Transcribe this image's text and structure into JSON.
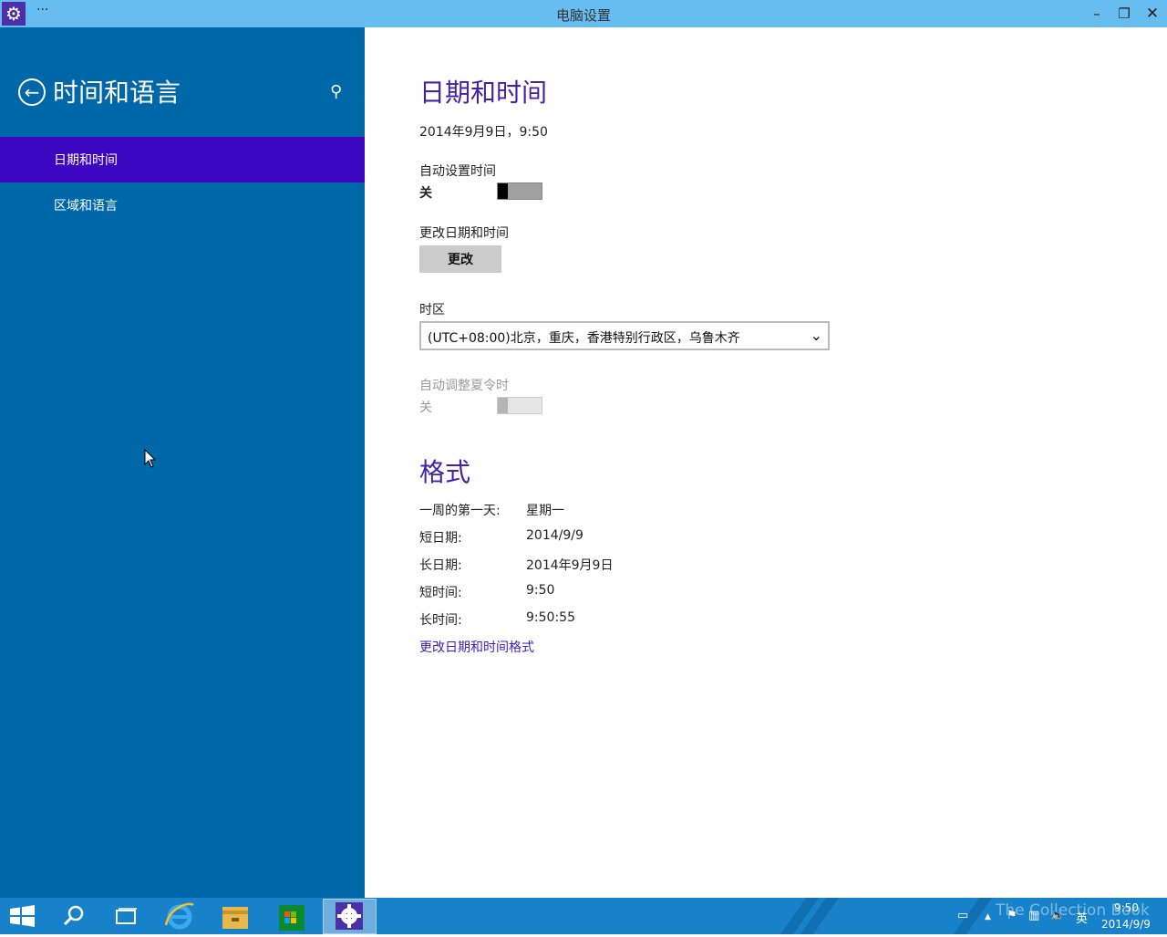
{
  "window": {
    "title": "电脑设置",
    "menu_glyph": "···",
    "controls": {
      "minimize": "–",
      "maximize": "❐",
      "close": "✕"
    }
  },
  "sidebar": {
    "title": "时间和语言",
    "items": [
      {
        "label": "日期和时间",
        "selected": true
      },
      {
        "label": "区域和语言",
        "selected": false
      }
    ]
  },
  "content": {
    "datetime_heading": "日期和时间",
    "current_datetime": "2014年9月9日，9:50",
    "auto_time": {
      "label": "自动设置时间",
      "state_label": "关",
      "on": false
    },
    "change_datetime": {
      "label": "更改日期和时间",
      "button": "更改"
    },
    "timezone": {
      "label": "时区",
      "value": "(UTC+08:00)北京，重庆，香港特别行政区，乌鲁木齐"
    },
    "auto_dst": {
      "label": "自动调整夏令时",
      "state_label": "关",
      "on": false,
      "disabled": true
    },
    "format_heading": "格式",
    "formats": [
      {
        "label": "一周的第一天:",
        "value": "星期一"
      },
      {
        "label": "短日期:",
        "value": "2014/9/9"
      },
      {
        "label": "长日期:",
        "value": "2014年9月9日"
      },
      {
        "label": "短时间:",
        "value": "9:50"
      },
      {
        "label": "长时间:",
        "value": "9:50:55"
      }
    ],
    "format_link": "更改日期和时间格式"
  },
  "taskbar": {
    "tray": {
      "ime": "英",
      "time": "9:50",
      "date": "2014/9/9"
    },
    "watermark": "The Collection Book"
  },
  "colors": {
    "titlebar": "#67bdf0",
    "sidebar_bg": "#0067a8",
    "sidebar_selected": "#3d07c2",
    "heading": "#4322a5",
    "taskbar": "#1782c9"
  }
}
